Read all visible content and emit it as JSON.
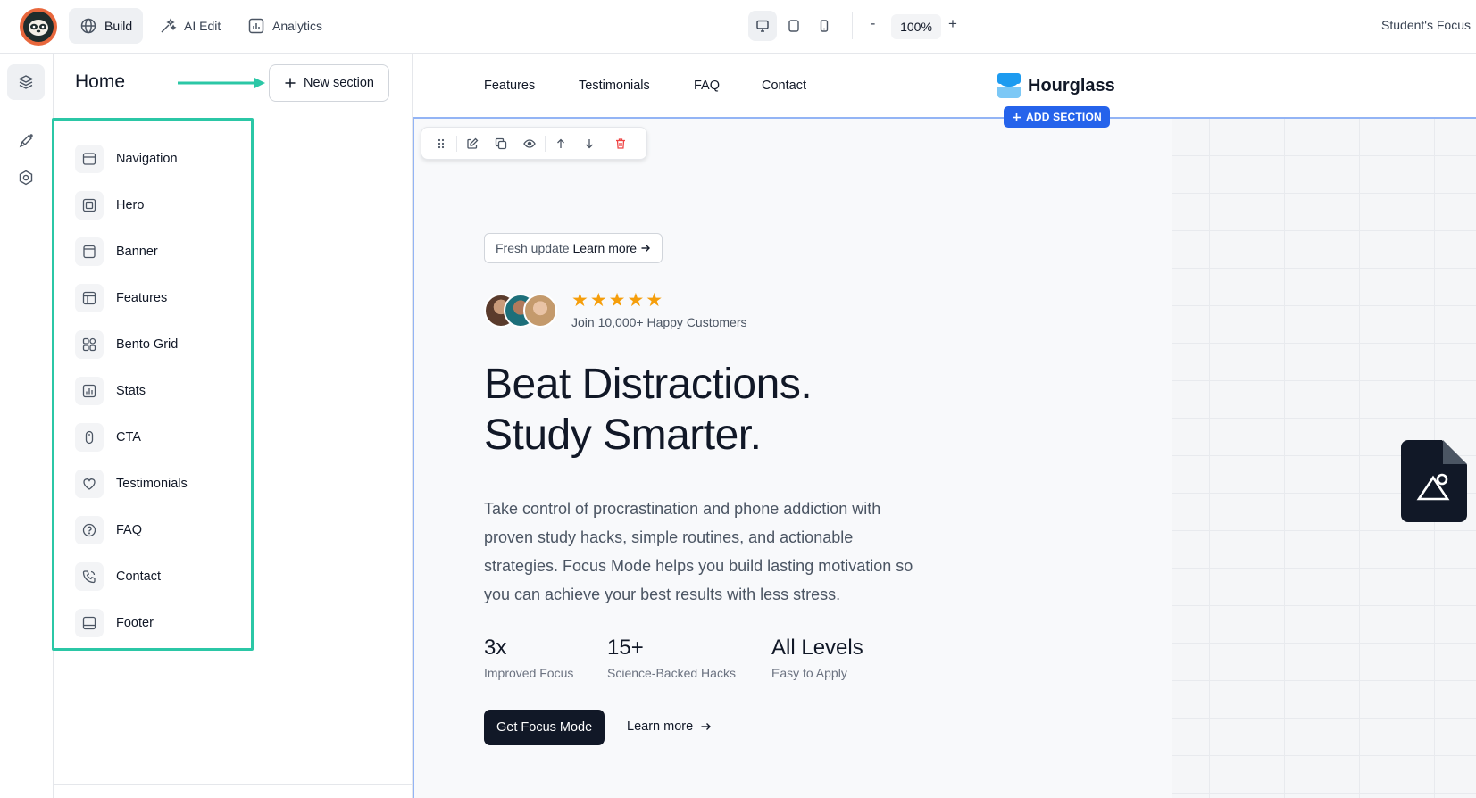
{
  "topbar": {
    "build_label": "Build",
    "ai_edit_label": "AI Edit",
    "analytics_label": "Analytics",
    "zoom": "100%",
    "zoom_minus": "-",
    "zoom_plus": "+",
    "project_name": "Student's Focus"
  },
  "panel": {
    "title": "Home",
    "new_section_label": "New section",
    "sections": [
      {
        "label": "Navigation",
        "icon": "navigation-icon"
      },
      {
        "label": "Hero",
        "icon": "hero-icon"
      },
      {
        "label": "Banner",
        "icon": "banner-icon"
      },
      {
        "label": "Features",
        "icon": "features-icon"
      },
      {
        "label": "Bento Grid",
        "icon": "bento-grid-icon"
      },
      {
        "label": "Stats",
        "icon": "stats-icon"
      },
      {
        "label": "CTA",
        "icon": "cta-icon"
      },
      {
        "label": "Testimonials",
        "icon": "heart-icon"
      },
      {
        "label": "FAQ",
        "icon": "question-icon"
      },
      {
        "label": "Contact",
        "icon": "phone-icon"
      },
      {
        "label": "Footer",
        "icon": "footer-icon"
      }
    ]
  },
  "site": {
    "nav": [
      "Features",
      "Testimonials",
      "FAQ",
      "Contact"
    ],
    "brand": "Hourglass",
    "add_section_label": "ADD SECTION",
    "pill_text": "Fresh update",
    "pill_link": "Learn more",
    "stars": "★★★★★",
    "customers": "Join 10,000+ Happy Customers",
    "headline_1": "Beat Distractions.",
    "headline_2": "Study Smarter.",
    "paragraph": "Take control of procrastination and phone addiction with proven study hacks, simple routines, and actionable strategies. Focus Mode helps you build lasting motivation so you can achieve your best results with less stress.",
    "stats": [
      {
        "value": "3x",
        "label": "Improved Focus"
      },
      {
        "value": "15+",
        "label": "Science-Backed Hacks"
      },
      {
        "value": "All Levels",
        "label": "Easy to Apply"
      }
    ],
    "cta_label": "Get Focus Mode",
    "learn_more": "Learn more"
  },
  "colors": {
    "accent_teal": "#2bc7a6",
    "selection_blue": "#2563eb",
    "star_gold": "#f59e0b",
    "dark": "#111827"
  }
}
